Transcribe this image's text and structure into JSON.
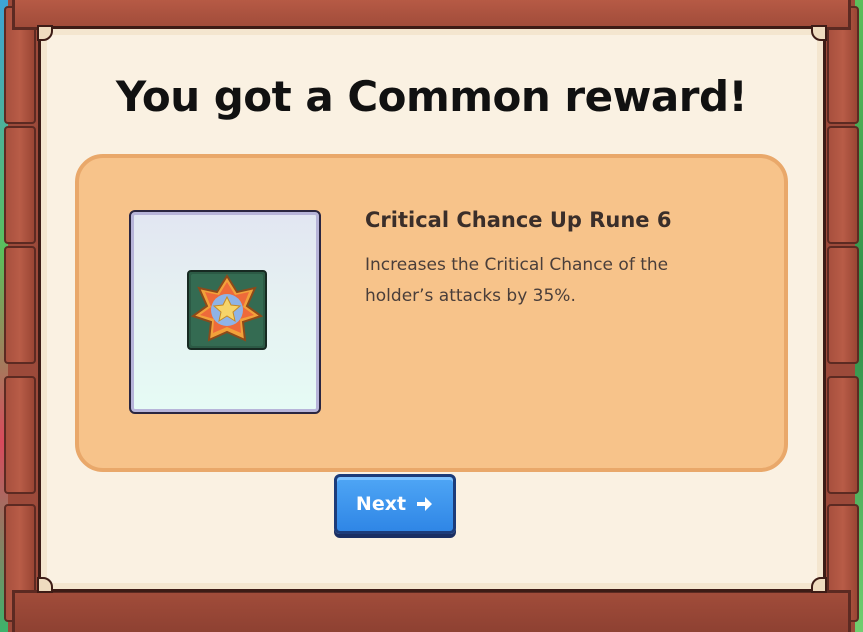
{
  "dialog": {
    "title": "You got a Common reward!"
  },
  "reward": {
    "name": "Critical Chance Up Rune 6",
    "description": "Increases the Critical Chance of the holder’s attacks by 35%.",
    "icon": "critical-chance-rune-icon"
  },
  "actions": {
    "next_label": "Next",
    "next_icon": "arrow-right-icon"
  },
  "colors": {
    "panel": "#f7c38a",
    "button": "#2f86e6",
    "parchment": "#faf1e2",
    "wood": "#9c4a3a"
  }
}
